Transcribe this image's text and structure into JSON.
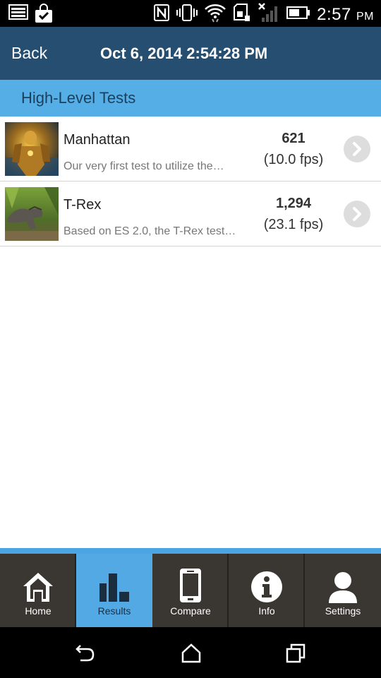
{
  "status_bar": {
    "time": "2:57",
    "ampm": "PM",
    "icons": [
      "image-icon",
      "shopping-bag-icon",
      "nfc-icon",
      "vibrate-icon",
      "wifi-icon",
      "sd-card-icon",
      "no-signal-icon",
      "battery-icon"
    ]
  },
  "action_bar": {
    "back_label": "Back",
    "title": "Oct 6, 2014 2:54:28 PM"
  },
  "section": {
    "title": "High-Level Tests"
  },
  "results": [
    {
      "name": "Manhattan",
      "description": "Our very first test to utilize the…",
      "score": "621",
      "fps": "(10.0 fps)",
      "thumbnail_icon": "manhattan-thumbnail"
    },
    {
      "name": "T-Rex",
      "description": "Based on ES 2.0, the T-Rex test…",
      "score": "1,294",
      "fps": "(23.1 fps)",
      "thumbnail_icon": "t-rex-thumbnail"
    }
  ],
  "tabs": [
    {
      "label": "Home",
      "icon": "home-icon",
      "active": false
    },
    {
      "label": "Results",
      "icon": "bar-chart-icon",
      "active": true
    },
    {
      "label": "Compare",
      "icon": "phone-icon",
      "active": false
    },
    {
      "label": "Info",
      "icon": "info-icon",
      "active": false
    },
    {
      "label": "Settings",
      "icon": "person-icon",
      "active": false
    }
  ],
  "nav_bar": {
    "icons": [
      "back-nav-icon",
      "home-nav-icon",
      "recents-nav-icon"
    ]
  },
  "colors": {
    "action_bar": "#254e70",
    "section_header": "#56aee6",
    "tab_bar": "#3a3632",
    "tab_active": "#53a9e4"
  }
}
